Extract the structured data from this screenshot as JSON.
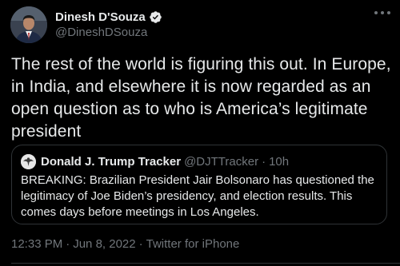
{
  "tweet": {
    "author": {
      "name": "Dinesh D'Souza",
      "handle": "@DineshDSouza",
      "verified": true,
      "avatar_icon": "profile-photo",
      "brand_color": "#1d9bf0"
    },
    "text": "The rest of the world is figuring this out. In Europe, in India, and elsewhere it is now regarded as an open question as to who is America’s legitimate president",
    "quote": {
      "name": "Donald J. Trump Tracker",
      "handle": "@DJTTracker",
      "separator": "·",
      "time": "10h",
      "text": "BREAKING: Brazilian President Jair Bolsonaro has questioned the legitimacy of Joe Biden’s presidency, and election results. This comes days before meetings in Los Angeles."
    },
    "meta": {
      "time": "12:33 PM",
      "separator": "·",
      "date": "Jun 8, 2022",
      "source": "Twitter for iPhone"
    }
  }
}
